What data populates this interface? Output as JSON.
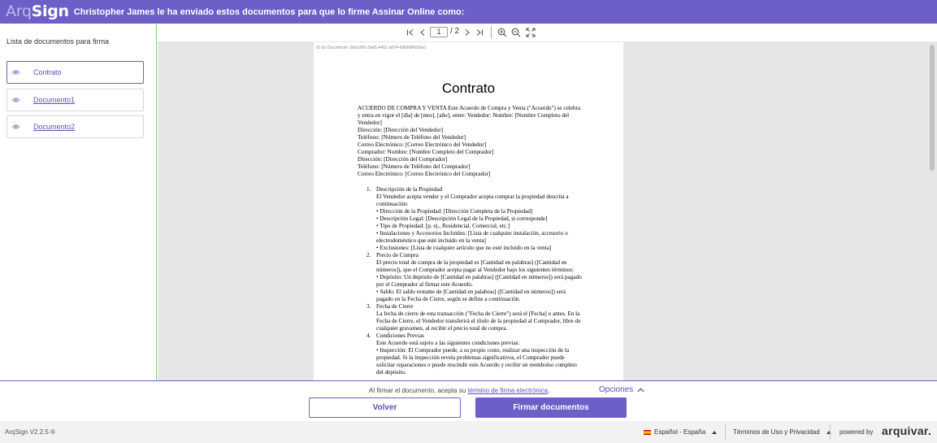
{
  "header": {
    "logo_arq": "Arq",
    "logo_sign": "Sign",
    "message": "Christopher James le ha enviado estos documentos para que lo firme Assinar Online como:"
  },
  "sidebar": {
    "title": "Lista de documentos para firma",
    "items": [
      {
        "label": "Contrato",
        "icon": "eye-icon",
        "active": true
      },
      {
        "label": "Documento1",
        "icon": "eye-icon",
        "active": false
      },
      {
        "label": "Documento2",
        "icon": "eye-icon",
        "active": false
      }
    ]
  },
  "toolbar": {
    "first_icon": "first-page-icon",
    "prev_icon": "prev-page-icon",
    "current_page": "1",
    "total_pages": "/ 2",
    "next_icon": "next-page-icon",
    "last_icon": "last-page-icon",
    "zoom_in_icon": "zoom-in-icon",
    "zoom_out_icon": "zoom-out-icon",
    "fullscreen_icon": "fullscreen-icon"
  },
  "document": {
    "doc_id": "ID do Documento: 0bb1df0c-5b45-4451-a874-49699842d9e1",
    "title": "Contrato",
    "intro": [
      "ACUERDO DE COMPRA Y VENTA Este Acuerdo de Compra y Venta (\"Acuerdo\") se celebra y entra en vigor el [día] de [mes], [año], entre: Vendedor: Nombre: [Nombre Completo del Vendedor]",
      "Dirección: [Dirección del Vendedor]",
      "Teléfono: [Número de Teléfono del Vendedor]",
      "Correo Electrónico: [Correo Electrónico del Vendedor]",
      "Comprador: Nombre: [Nombre Completo del Comprador]",
      "Dirección: [Dirección del Comprador]",
      "Teléfono: [Número de Teléfono del Comprador]",
      "Correo Electrónico: [Correo Electrónico del Comprador]"
    ],
    "sections": [
      {
        "num": "1.",
        "lines": [
          "Descripción de la Propiedad",
          "El Vendedor acepta vender y el Comprador acepta comprar la propiedad descrita a continuación:",
          "• Dirección de la Propiedad: [Dirección Completa de la Propiedad]",
          "• Descripción Legal: [Descripción Legal de la Propiedad, si corresponde]",
          "• Tipo de Propiedad: [p. ej., Residencial, Comercial, etc.]",
          "• Instalaciones y Accesorios Incluidos: [Lista de cualquier instalación, accesorio o electrodoméstico que esté incluido en la venta]",
          "• Exclusiones: [Lista de cualquier artículo que no esté incluido en la venta]"
        ]
      },
      {
        "num": "2.",
        "lines": [
          "Precio de Compra",
          "El precio total de compra de la propiedad es [Cantidad en palabras] ([Cantidad en números]), que el Comprador acepta pagar al Vendedor bajo los siguientes términos:",
          "• Depósito: Un depósito de [Cantidad en palabras] ([Cantidad en números]) será pagado por el Comprador al firmar este Acuerdo.",
          "• Saldo: El saldo restante de [Cantidad en palabras] ([Cantidad en números]) será pagado en la Fecha de Cierre, según se define a continuación."
        ]
      },
      {
        "num": "3.",
        "lines": [
          "Fecha de Cierre",
          "La fecha de cierre de esta transacción (\"Fecha de Cierre\") será el [Fecha] o antes. En la Fecha de Cierre, el Vendedor transferirá el título de la propiedad al Comprador, libre de cualquier gravamen, al recibir el precio total de compra."
        ]
      },
      {
        "num": "4.",
        "lines": [
          "Condiciones Previas",
          "Este Acuerdo está sujeto a las siguientes condiciones previas:",
          "• Inspección: El Comprador puede, a su propio costo, realizar una inspección de la propiedad. Si la inspección revela problemas significativos, el Comprador puede solicitar reparaciones o puede rescindir este Acuerdo y recibir un reembolso completo del depósito."
        ]
      }
    ]
  },
  "actions": {
    "accept_prefix": "Al firmar el documento, acepta su ",
    "accept_link": "término de firma electrónica",
    "accept_suffix": ".",
    "options_label": "Opciones",
    "back_label": "Volver",
    "sign_label": "Firmar documentos"
  },
  "footer": {
    "version": "ArqSign V2.2.5 ®",
    "language": "Español - España",
    "terms": "Términos de Uso y Privacidad",
    "powered_by": "powered by",
    "brand": "arquivar."
  },
  "colors": {
    "accent": "#6c5fc7",
    "accent_text": "#5a4fb8",
    "viewer_bg": "#e6e6e6",
    "footer_bg": "#f2f2f2"
  }
}
